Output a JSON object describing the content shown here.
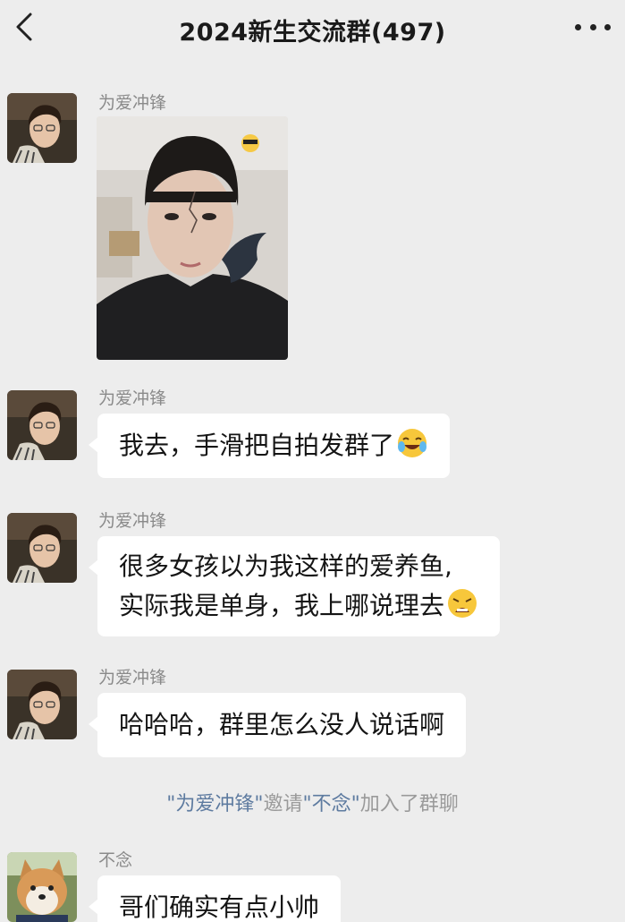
{
  "header": {
    "title": "2024新生交流群(497)",
    "back_icon": "chevron-left-icon",
    "more_icon": "more-dots-icon"
  },
  "messages": [
    {
      "sender": "为爱冲锋",
      "type": "image",
      "avatar": "young-man-avatar"
    },
    {
      "sender": "为爱冲锋",
      "type": "text",
      "lines": [
        "我去，手滑把自拍发群了"
      ],
      "emoji": "laughing-tears-emoji"
    },
    {
      "sender": "为爱冲锋",
      "type": "text",
      "lines": [
        "很多女孩以为我这样的爱养鱼,",
        "实际我是单身，我上哪说理去"
      ],
      "emoji": "weary-emoji"
    },
    {
      "sender": "为爱冲锋",
      "type": "text",
      "lines": [
        "哈哈哈，群里怎么没人说话啊"
      ]
    },
    {
      "sender": "不念",
      "type": "text",
      "lines": [
        "哥们确实有点小帅"
      ],
      "avatar": "shiba-dog-avatar"
    }
  ],
  "system_notice": {
    "inviter": "\"为爱冲锋\"",
    "invite_word": "邀请",
    "invitee": "\"不念\"",
    "suffix": "加入了群聊"
  }
}
